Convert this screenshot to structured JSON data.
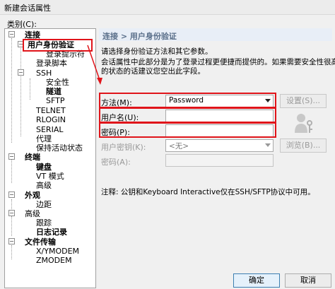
{
  "window": {
    "title": "新建会话属性"
  },
  "category_label": "类别(C):",
  "tree": [
    {
      "label": "连接"
    },
    {
      "label": "用户身份验证"
    },
    {
      "label": "登录提示符"
    },
    {
      "label": "登录脚本"
    },
    {
      "label": "SSH"
    },
    {
      "label": "安全性"
    },
    {
      "label": "隧道"
    },
    {
      "label": "SFTP"
    },
    {
      "label": "TELNET"
    },
    {
      "label": "RLOGIN"
    },
    {
      "label": "SERIAL"
    },
    {
      "label": "代理"
    },
    {
      "label": "保持活动状态"
    },
    {
      "label": "终端"
    },
    {
      "label": "键盘"
    },
    {
      "label": "VT 模式"
    },
    {
      "label": "高级"
    },
    {
      "label": "外观"
    },
    {
      "label": "边距"
    },
    {
      "label": "高级"
    },
    {
      "label": "跟踪"
    },
    {
      "label": "日志记录"
    },
    {
      "label": "文件传输"
    },
    {
      "label": "X/YMODEM"
    },
    {
      "label": "ZMODEM"
    }
  ],
  "panel": {
    "header": "连接 > 用户身份验证",
    "desc1": "请选择身份验证方法和其它参数。",
    "desc2": "会话属性中此部分是为了登录过程更便捷而提供的。如果需要安全性很高",
    "desc3": "的状态的话建议您空出此字段。",
    "method_label": "方法(M):",
    "method_value": "Password",
    "setup_button": "设置(S)...",
    "username_label": "用户名(U):",
    "username_value": "",
    "password_label": "密码(P):",
    "password_value": "",
    "userkey_label": "用户密钥(K):",
    "userkey_value": "<无>",
    "browse_button": "浏览(B)...",
    "passphrase_label": "密码(A):",
    "passphrase_value": "",
    "note": "注释: 公钥和Keyboard Interactive仅在SSH/SFTP协议中可用。"
  },
  "footer": {
    "ok_button": "确定",
    "cancel_button": "取消"
  },
  "colors": {
    "highlight_red": "#e0141a",
    "header_bg": "#e8eef7",
    "header_text": "#5a6f8a"
  }
}
